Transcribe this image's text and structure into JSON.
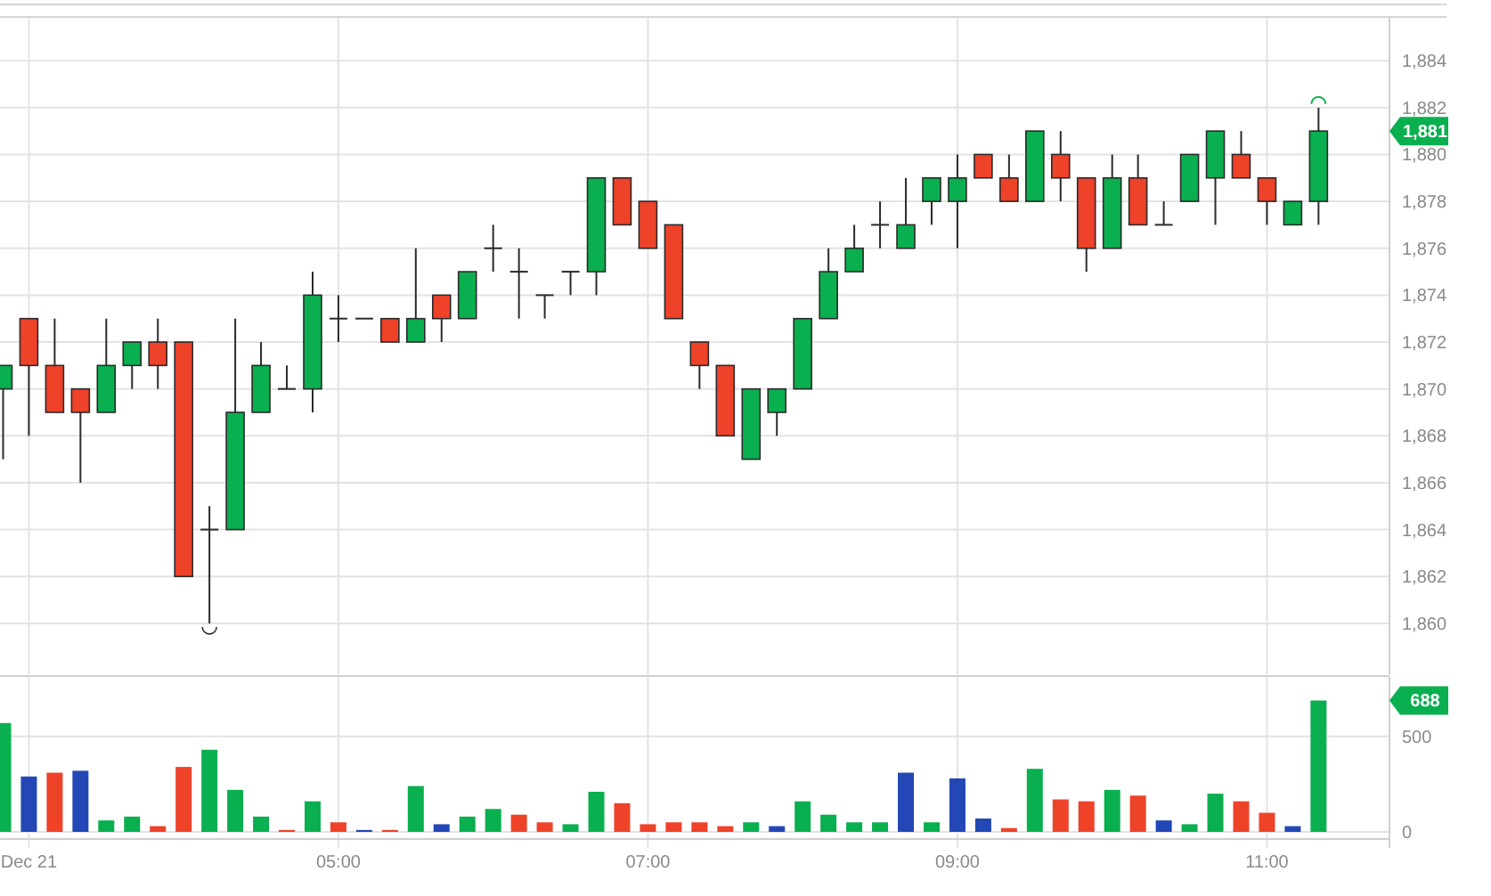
{
  "price_chart": {
    "last_price_tag": "1,881",
    "chart_data": {
      "type": "candlestick",
      "grid": true,
      "categories": [
        null,
        null,
        null,
        null,
        null,
        null,
        null,
        null,
        null,
        null,
        null,
        null,
        null,
        null,
        null,
        null,
        null,
        null,
        null,
        null,
        null,
        null,
        null,
        null,
        null,
        null,
        null,
        null,
        null,
        null,
        null,
        null,
        null,
        null,
        null,
        null,
        null,
        null,
        null,
        null,
        null,
        null,
        null,
        null,
        null,
        null,
        null,
        null,
        null,
        null,
        null,
        null
      ],
      "ohlc": [
        [
          1870,
          1871,
          1867,
          1871
        ],
        [
          1873,
          1873,
          1868,
          1871
        ],
        [
          1871,
          1873,
          1869,
          1869
        ],
        [
          1870,
          1870,
          1866,
          1869
        ],
        [
          1869,
          1873,
          1869,
          1871
        ],
        [
          1871,
          1872,
          1870,
          1872
        ],
        [
          1872,
          1873,
          1870,
          1871
        ],
        [
          1872,
          1872,
          1862,
          1862
        ],
        [
          1864,
          1865,
          1860,
          1864
        ],
        [
          1864,
          1873,
          1864,
          1869
        ],
        [
          1869,
          1872,
          1869,
          1871
        ],
        [
          1870,
          1871,
          1870,
          1870
        ],
        [
          1870,
          1875,
          1869,
          1874
        ],
        [
          1873,
          1874,
          1872,
          1873
        ],
        [
          1873,
          1873,
          1873,
          1873
        ],
        [
          1873,
          1873,
          1872,
          1872
        ],
        [
          1872,
          1876,
          1872,
          1873
        ],
        [
          1874,
          1874,
          1872,
          1873
        ],
        [
          1873,
          1875,
          1873,
          1875
        ],
        [
          1876,
          1877,
          1875,
          1876
        ],
        [
          1875,
          1876,
          1873,
          1875
        ],
        [
          1874,
          1874,
          1873,
          1874
        ],
        [
          1875,
          1875,
          1874,
          1875
        ],
        [
          1875,
          1879,
          1874,
          1879
        ],
        [
          1879,
          1879,
          1877,
          1877
        ],
        [
          1878,
          1878,
          1876,
          1876
        ],
        [
          1877,
          1877,
          1873,
          1873
        ],
        [
          1872,
          1872,
          1870,
          1871
        ],
        [
          1871,
          1871,
          1868,
          1868
        ],
        [
          1867,
          1870,
          1867,
          1870
        ],
        [
          1869,
          1870,
          1868,
          1870
        ],
        [
          1870,
          1873,
          1870,
          1873
        ],
        [
          1873,
          1876,
          1873,
          1875
        ],
        [
          1875,
          1877,
          1875,
          1876
        ],
        [
          1877,
          1878,
          1876,
          1877
        ],
        [
          1876,
          1879,
          1876,
          1877
        ],
        [
          1878,
          1879,
          1877,
          1879
        ],
        [
          1878,
          1880,
          1876,
          1879
        ],
        [
          1880,
          1880,
          1879,
          1879
        ],
        [
          1879,
          1880,
          1878,
          1878
        ],
        [
          1878,
          1881,
          1878,
          1881
        ],
        [
          1880,
          1881,
          1878,
          1879
        ],
        [
          1879,
          1879,
          1875,
          1876
        ],
        [
          1876,
          1880,
          1876,
          1879
        ],
        [
          1879,
          1880,
          1877,
          1877
        ],
        [
          1877,
          1878,
          1877,
          1877
        ],
        [
          1878,
          1880,
          1878,
          1880
        ],
        [
          1879,
          1881,
          1877,
          1881
        ],
        [
          1880,
          1881,
          1879,
          1879
        ],
        [
          1879,
          1879,
          1877,
          1878
        ],
        [
          1877,
          1878,
          1877,
          1878
        ],
        [
          1878,
          1882,
          1877,
          1881
        ]
      ],
      "ylim": [
        1857.83,
        1885.83
      ],
      "yticks": [
        {
          "value": 1860,
          "label": "1,860"
        },
        {
          "value": 1862,
          "label": "1,862"
        },
        {
          "value": 1864,
          "label": "1,864"
        },
        {
          "value": 1866,
          "label": "1,866"
        },
        {
          "value": 1868,
          "label": "1,868"
        },
        {
          "value": 1870,
          "label": "1,870"
        },
        {
          "value": 1872,
          "label": "1,872"
        },
        {
          "value": 1874,
          "label": "1,874"
        },
        {
          "value": 1876,
          "label": "1,876"
        },
        {
          "value": 1878,
          "label": "1,878"
        },
        {
          "value": 1880,
          "label": "1,880"
        },
        {
          "value": 1882,
          "label": "1,882"
        },
        {
          "value": 1884,
          "label": "1,884"
        }
      ]
    }
  },
  "volume_chart": {
    "last_volume_tag": "688",
    "chart_data": {
      "type": "bar",
      "grid": true,
      "categories": [
        null,
        "Dec 21",
        null,
        null,
        null,
        null,
        null,
        null,
        null,
        null,
        null,
        null,
        null,
        "05:00",
        null,
        null,
        null,
        null,
        null,
        null,
        null,
        null,
        null,
        null,
        null,
        "07:00",
        null,
        null,
        null,
        null,
        null,
        null,
        null,
        null,
        null,
        null,
        null,
        "09:00",
        null,
        null,
        null,
        null,
        null,
        null,
        null,
        null,
        null,
        null,
        null,
        "11:00",
        null,
        null
      ],
      "series": [
        {
          "color": "#0aaf4f",
          "values": [
            570,
            null,
            null,
            null,
            60,
            80,
            null,
            null,
            430,
            220,
            80,
            null,
            160,
            null,
            null,
            null,
            240,
            null,
            80,
            120,
            null,
            null,
            40,
            210,
            null,
            null,
            null,
            null,
            null,
            50,
            null,
            160,
            90,
            50,
            50,
            null,
            50,
            null,
            null,
            null,
            330,
            null,
            null,
            220,
            null,
            null,
            40,
            200,
            null,
            null,
            null,
            688
          ]
        },
        {
          "color": "#ee4229",
          "values": [
            null,
            null,
            310,
            null,
            null,
            null,
            30,
            340,
            null,
            null,
            null,
            10,
            null,
            50,
            null,
            10,
            null,
            null,
            null,
            null,
            90,
            50,
            null,
            null,
            150,
            40,
            50,
            50,
            30,
            null,
            null,
            null,
            null,
            null,
            null,
            null,
            null,
            null,
            null,
            20,
            null,
            170,
            160,
            null,
            190,
            null,
            null,
            null,
            160,
            100,
            null,
            null
          ]
        },
        {
          "color": "#2347b5",
          "values": [
            null,
            290,
            null,
            320,
            null,
            null,
            null,
            null,
            null,
            null,
            null,
            null,
            null,
            null,
            10,
            null,
            null,
            40,
            null,
            null,
            null,
            null,
            null,
            null,
            null,
            null,
            null,
            null,
            null,
            null,
            30,
            null,
            null,
            null,
            null,
            310,
            null,
            280,
            70,
            null,
            null,
            null,
            null,
            null,
            null,
            60,
            null,
            null,
            null,
            null,
            30,
            null
          ]
        }
      ],
      "ylim": [
        -28,
        811.6
      ],
      "yticks": [
        0,
        500
      ]
    }
  }
}
